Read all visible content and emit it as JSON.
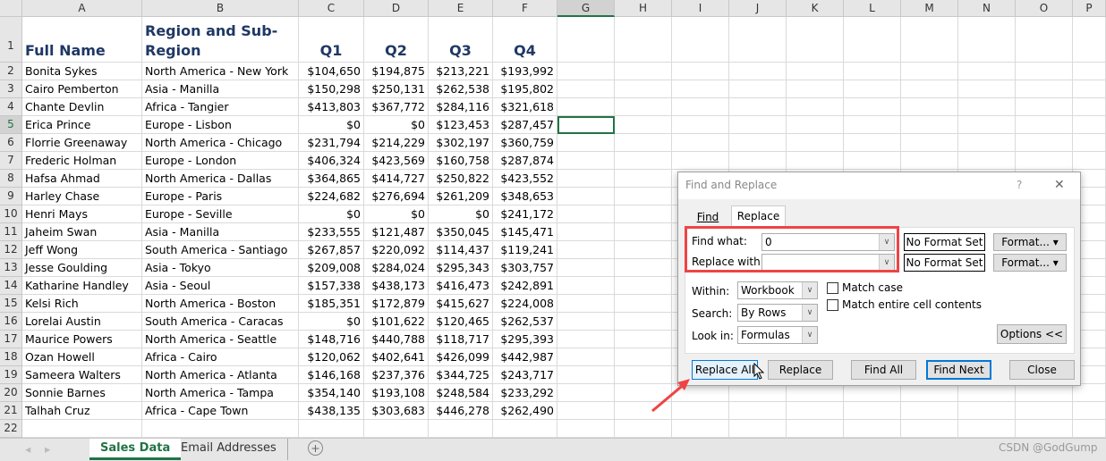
{
  "columns": [
    "A",
    "B",
    "C",
    "D",
    "E",
    "F",
    "G",
    "H",
    "I",
    "J",
    "K",
    "L",
    "M",
    "N",
    "O",
    "P"
  ],
  "headers": [
    "Full Name",
    "Region and Sub-Region",
    "Q1",
    "Q2",
    "Q3",
    "Q4"
  ],
  "rows": [
    [
      "Bonita Sykes",
      "North America - New York",
      "$104,650",
      "$194,875",
      "$213,221",
      "$193,992"
    ],
    [
      "Cairo Pemberton",
      "Asia - Manilla",
      "$150,298",
      "$250,131",
      "$262,538",
      "$195,802"
    ],
    [
      "Chante Devlin",
      "Africa - Tangier",
      "$413,803",
      "$367,772",
      "$284,116",
      "$321,618"
    ],
    [
      "Erica Prince",
      "Europe - Lisbon",
      "$0",
      "$0",
      "$123,453",
      "$287,457"
    ],
    [
      "Florrie Greenaway",
      "North America - Chicago",
      "$231,794",
      "$214,229",
      "$302,197",
      "$360,759"
    ],
    [
      "Frederic Holman",
      "Europe - London",
      "$406,324",
      "$423,569",
      "$160,758",
      "$287,874"
    ],
    [
      "Hafsa Ahmad",
      "North America - Dallas",
      "$364,865",
      "$414,727",
      "$250,822",
      "$423,552"
    ],
    [
      "Harley Chase",
      "Europe - Paris",
      "$224,682",
      "$276,694",
      "$261,209",
      "$348,653"
    ],
    [
      "Henri Mays",
      "Europe - Seville",
      "$0",
      "$0",
      "$0",
      "$241,172"
    ],
    [
      "Jaheim Swan",
      "Asia - Manilla",
      "$233,555",
      "$121,487",
      "$350,045",
      "$145,471"
    ],
    [
      "Jeff Wong",
      "South America - Santiago",
      "$267,857",
      "$220,092",
      "$114,437",
      "$119,241"
    ],
    [
      "Jesse Goulding",
      "Asia - Tokyo",
      "$209,008",
      "$284,024",
      "$295,343",
      "$303,757"
    ],
    [
      "Katharine Handley",
      "Asia - Seoul",
      "$157,338",
      "$438,173",
      "$416,473",
      "$242,891"
    ],
    [
      "Kelsi Rich",
      "North America - Boston",
      "$185,351",
      "$172,879",
      "$415,627",
      "$224,008"
    ],
    [
      "Lorelai Austin",
      "South America - Caracas",
      "$0",
      "$101,622",
      "$120,465",
      "$262,537"
    ],
    [
      "Maurice Powers",
      "North America - Seattle",
      "$148,716",
      "$440,788",
      "$118,717",
      "$295,393"
    ],
    [
      "Ozan Howell",
      "Africa - Cairo",
      "$120,062",
      "$402,641",
      "$426,099",
      "$442,987"
    ],
    [
      "Sameera Walters",
      "North America - Atlanta",
      "$146,168",
      "$237,376",
      "$344,725",
      "$243,717"
    ],
    [
      "Sonnie Barnes",
      "North America - Tampa",
      "$354,140",
      "$193,108",
      "$248,584",
      "$233,292"
    ],
    [
      "Talhah Cruz",
      "Africa - Cape Town",
      "$438,135",
      "$303,683",
      "$446,278",
      "$262,490"
    ]
  ],
  "sheet_tabs": [
    "Sales Data",
    "Email Addresses"
  ],
  "active_tab": "Sales Data",
  "watermark": "CSDN @GodGump",
  "dialog": {
    "title": "Find and Replace",
    "help": "?",
    "close": "✕",
    "tabs": [
      "Find",
      "Replace"
    ],
    "active_tab": "Replace",
    "find_label": "Find what:",
    "find_value": "0",
    "replace_label": "Replace with:",
    "replace_value": "",
    "no_format": "No Format Set",
    "format_btn": "Format...",
    "within_label": "Within:",
    "within_value": "Workbook",
    "search_label": "Search:",
    "search_value": "By Rows",
    "lookin_label": "Look in:",
    "lookin_value": "Formulas",
    "match_case": "Match case",
    "match_entire": "Match entire cell contents",
    "match_case_checked": false,
    "match_entire_checked": false,
    "options_btn": "Options <<",
    "buttons": [
      "Replace All",
      "Replace",
      "Find All",
      "Find Next",
      "Close"
    ]
  },
  "colors": {
    "highlight": "#ef4444",
    "header_text": "#1f3864",
    "active_tab": "#217346",
    "focus": "#0078d7"
  }
}
